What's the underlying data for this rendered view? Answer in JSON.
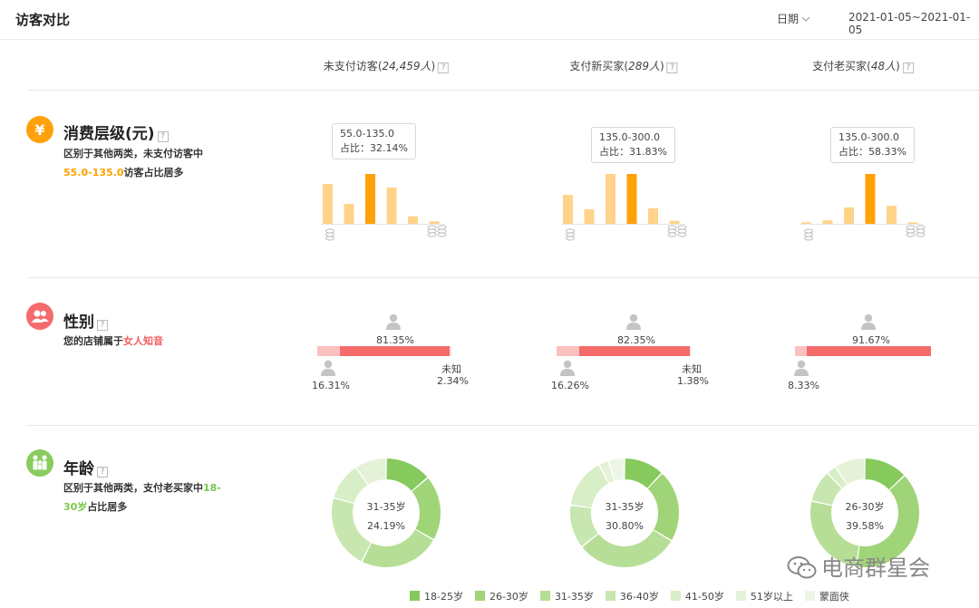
{
  "header": {
    "title": "访客对比",
    "date_label": "日期",
    "date_range": "2021-01-05~2021-01-05"
  },
  "columns": [
    {
      "name": "未支付访客",
      "count": "24,459人"
    },
    {
      "name": "支付新买家",
      "count": "289人"
    },
    {
      "name": "支付老买家",
      "count": "48人"
    }
  ],
  "sections": {
    "spend": {
      "title": "消费层级(元)",
      "icon_glyph": "¥",
      "desc_pre": "区别于其他两类，未支付访客中",
      "desc_hl": "55.0-135.0",
      "desc_post": "访客占比居多",
      "tooltips": [
        {
          "range": "55.0-135.0",
          "share": "占比：32.14%"
        },
        {
          "range": "135.0-300.0",
          "share": "占比：31.83%"
        },
        {
          "range": "135.0-300.0",
          "share": "占比：58.33%"
        }
      ]
    },
    "gender": {
      "title": "性别",
      "desc_pre": "您的店铺属于",
      "desc_hl": "女人知音",
      "unknown_label": "未知",
      "cols": [
        {
          "female": "81.35%",
          "male": "16.31%",
          "unknown": "2.34%"
        },
        {
          "female": "82.35%",
          "male": "16.26%",
          "unknown": "1.38%"
        },
        {
          "female": "91.67%",
          "male": "8.33%"
        }
      ]
    },
    "age": {
      "title": "年龄",
      "desc_pre": "区别于其他两类，支付老买家中",
      "desc_hl": "18-30岁",
      "desc_post": "占比居多",
      "centers": [
        {
          "label": "31-35岁",
          "pct": "24.19%"
        },
        {
          "label": "31-35岁",
          "pct": "30.80%"
        },
        {
          "label": "26-30岁",
          "pct": "39.58%"
        }
      ],
      "legend": [
        "18-25岁",
        "26-30岁",
        "31-35岁",
        "36-40岁",
        "41-50岁",
        "51岁以上",
        "蒙面侠"
      ]
    }
  },
  "chart_data": [
    {
      "type": "bar",
      "title": "",
      "highlight_index": 2,
      "values": [
        0.8,
        0.4,
        1.0,
        0.73,
        0.15,
        0.05
      ]
    },
    {
      "type": "bar",
      "title": "",
      "highlight_index": 3,
      "values": [
        0.58,
        0.29,
        1.0,
        1.0,
        0.31,
        0.06
      ]
    },
    {
      "type": "bar",
      "title": "",
      "highlight_index": 3,
      "values": [
        0.03,
        0.07,
        0.33,
        1.0,
        0.36,
        0.03
      ]
    },
    {
      "type": "pie",
      "title": "",
      "categories": [
        "18-25岁",
        "26-30岁",
        "31-35岁",
        "36-40岁",
        "41-50岁",
        "51岁以上",
        "蒙面侠"
      ],
      "values": [
        13.8,
        19.4,
        24.19,
        22.1,
        11.2,
        9.3,
        0
      ]
    },
    {
      "type": "pie",
      "title": "",
      "categories": [
        "18-25岁",
        "26-30岁",
        "31-35岁",
        "36-40岁",
        "41-50岁",
        "51岁以上",
        "蒙面侠"
      ],
      "values": [
        12.0,
        21.5,
        30.8,
        13.0,
        14.9,
        3.0,
        4.8
      ]
    },
    {
      "type": "pie",
      "title": "",
      "categories": [
        "18-25岁",
        "26-30岁",
        "31-35岁",
        "36-40岁",
        "41-50岁",
        "51岁以上",
        "蒙面侠"
      ],
      "values": [
        13.0,
        39.58,
        26.0,
        9.5,
        3.0,
        9.0,
        0
      ]
    }
  ],
  "colors": {
    "bar_normal": "#ffd38a",
    "bar_highlight": "#ffa10a",
    "female": "#f56b6b",
    "male": "#fbc0c0",
    "unknown": "#fbe2e2",
    "age": [
      "#86c95d",
      "#a0d478",
      "#b6de96",
      "#c8e6b0",
      "#d8eec6",
      "#e4f3d8",
      "#edf6e6"
    ]
  },
  "watermark": "电商群星会"
}
